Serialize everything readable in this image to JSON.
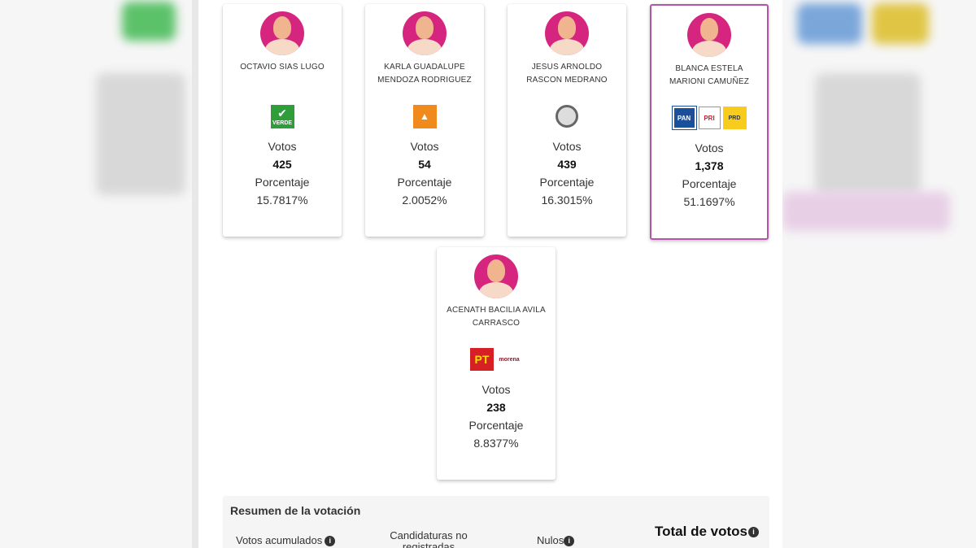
{
  "labels": {
    "votes": "Votos",
    "percentage": "Porcentaje"
  },
  "candidates": [
    {
      "name": "OCTAVIO SIAS LUGO",
      "votes": "425",
      "percentage": "15.7817%",
      "parties": [
        "VERDE"
      ]
    },
    {
      "name": "KARLA GUADALUPE MENDOZA RODRIGUEZ",
      "votes": "54",
      "percentage": "2.0052%",
      "parties": [
        "MC"
      ]
    },
    {
      "name": "JESUS ARNOLDO RASCON MEDRANO",
      "votes": "439",
      "percentage": "16.3015%",
      "parties": [
        "Independiente"
      ]
    },
    {
      "name": "BLANCA ESTELA MARIONI CAMUÑEZ",
      "votes": "1,378",
      "percentage": "51.1697%",
      "parties": [
        "PAN",
        "PRI",
        "PRD"
      ]
    },
    {
      "name": "ACENATH BACILIA AVILA CARRASCO",
      "votes": "238",
      "percentage": "8.8377%",
      "parties": [
        "PT",
        "morena"
      ]
    }
  ],
  "summary": {
    "title": "Resumen de la votación",
    "accumulated": "Votos acumulados",
    "unregistered": "Candidaturas no registradas",
    "nulls": "Nulos",
    "total": "Total de votos"
  },
  "logo_text": {
    "verde": "VERDE",
    "pan": "PAN",
    "pri": "PRI",
    "prd": "PRD",
    "pt": "PT",
    "morena": "morena"
  },
  "colors": {
    "avatar": "#d6257f",
    "winner_border": "#b455a8"
  }
}
